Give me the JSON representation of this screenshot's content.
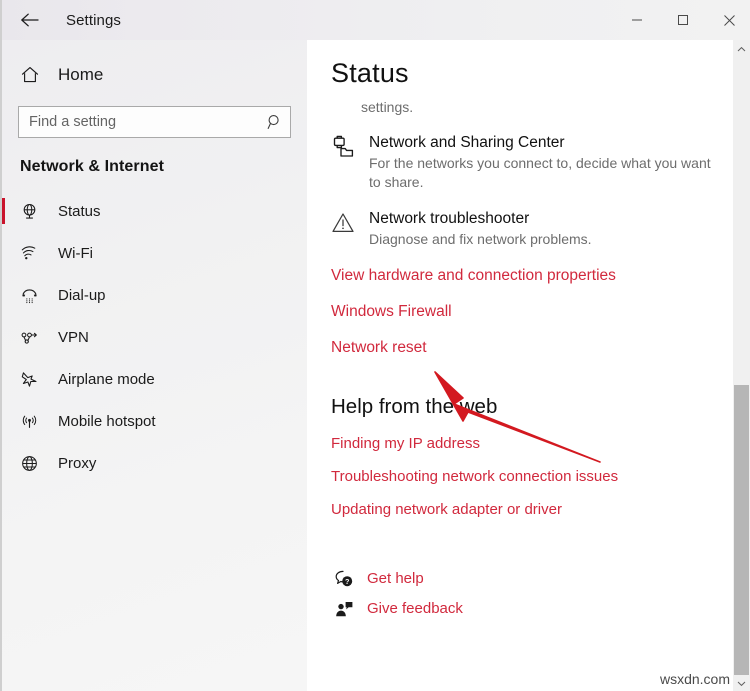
{
  "window": {
    "title": "Settings",
    "back_icon": "back-arrow-icon",
    "controls": {
      "minimize": "minimize-icon",
      "maximize": "maximize-icon",
      "close": "close-icon"
    }
  },
  "sidebar": {
    "home": {
      "label": "Home",
      "icon": "home-icon"
    },
    "search": {
      "placeholder": "Find a setting",
      "value": "",
      "icon": "search-icon"
    },
    "category": "Network & Internet",
    "accent_color": "#c9132b",
    "items": [
      {
        "label": "Status",
        "icon": "globe-status-icon",
        "selected": true
      },
      {
        "label": "Wi-Fi",
        "icon": "wifi-icon",
        "selected": false
      },
      {
        "label": "Dial-up",
        "icon": "dialup-phone-icon",
        "selected": false
      },
      {
        "label": "VPN",
        "icon": "vpn-icon",
        "selected": false
      },
      {
        "label": "Airplane mode",
        "icon": "airplane-icon",
        "selected": false
      },
      {
        "label": "Mobile hotspot",
        "icon": "hotspot-icon",
        "selected": false
      },
      {
        "label": "Proxy",
        "icon": "globe-icon",
        "selected": false
      }
    ]
  },
  "main": {
    "title": "Status",
    "intro_truncated": "settings.",
    "features": [
      {
        "title": "Network and Sharing Center",
        "desc": "For the networks you connect to, decide what you want to share.",
        "icon": "network-sharing-icon"
      },
      {
        "title": "Network troubleshooter",
        "desc": "Diagnose and fix network problems.",
        "icon": "warning-triangle-icon"
      }
    ],
    "links": [
      "View hardware and connection properties",
      "Windows Firewall",
      "Network reset"
    ],
    "link_color": "#d1293d",
    "help_section": {
      "heading": "Help from the web",
      "links": [
        "Finding my IP address",
        "Troubleshooting network connection issues",
        "Updating network adapter or driver"
      ]
    },
    "support": [
      {
        "label": "Get help",
        "icon": "get-help-icon"
      },
      {
        "label": "Give feedback",
        "icon": "give-feedback-icon"
      }
    ]
  },
  "annotation": {
    "type": "arrow",
    "color": "#d31920",
    "points_to": "Network reset"
  },
  "watermark": "wsxdn.com"
}
